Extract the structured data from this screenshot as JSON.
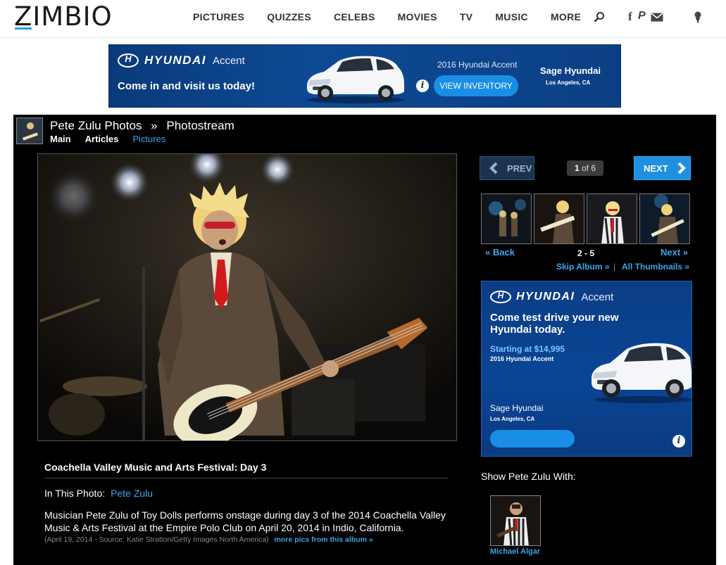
{
  "header": {
    "logo": "ZIMBIO",
    "nav": [
      "PICTURES",
      "QUIZZES",
      "CELEBS",
      "MOVIES",
      "TV",
      "MUSIC",
      "MORE"
    ],
    "icons": [
      "search-icon",
      "facebook-icon",
      "pinterest-icon",
      "mail-icon",
      "user-icon"
    ],
    "icon_glyphs": {
      "facebook": "f",
      "pinterest": "P"
    }
  },
  "ad_top": {
    "brand": "HYUNDAI",
    "model": "Accent",
    "tagline": "Come in and visit us today!",
    "product": "2016 Hyundai Accent",
    "cta": "VIEW INVENTORY",
    "dealer": "Sage Hyundai",
    "location": "Los Angeles, CA",
    "info": "i"
  },
  "breadcrumb": {
    "parent": "Pete Zulu Photos",
    "separator": "»",
    "current": "Photostream"
  },
  "subnav": [
    "Main",
    "Articles",
    "Pictures"
  ],
  "gallery": {
    "prev_label": "PREV",
    "next_label": "NEXT",
    "current": "1",
    "of_text": "of 6",
    "back_label": "« Back",
    "range": "2 - 5",
    "next_link": "Next »",
    "skip_album": "Skip Album »",
    "divider": "|",
    "all_thumbnails": "All Thumbnails »"
  },
  "ad_side": {
    "brand": "HYUNDAI",
    "model": "Accent",
    "headline": "Come test drive your new Hyundai today.",
    "price": "Starting at $14,995",
    "product": "2016 Hyundai Accent",
    "dealer": "Sage Hyundai",
    "location": "Los Angeles, CA",
    "info": "i"
  },
  "caption": {
    "title": "Coachella Valley Music and Arts Festival: Day 3",
    "in_photo_label": "In This Photo:",
    "in_photo_name": "Pete Zulu",
    "description": "Musician Pete Zulu of Toy Dolls performs onstage during day 3 of the 2014 Coachella Valley Music & Arts Festival at the Empire Polo Club on April 20, 2014 in Indio, California.",
    "source": "(April 19, 2014 - Source: Katie Stratton/Getty Images North America)",
    "more_link": "more pics from this album »"
  },
  "related": {
    "heading": "Show Pete Zulu With:",
    "name": "Michael Algar"
  }
}
